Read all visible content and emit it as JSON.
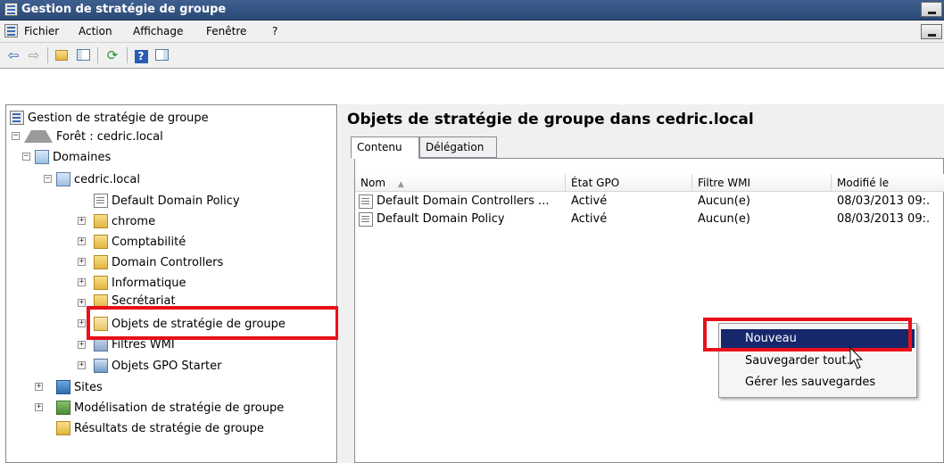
{
  "window": {
    "title": "Gestion de stratégie de groupe"
  },
  "menu": {
    "items": [
      "Fichier",
      "Action",
      "Affichage",
      "Fenêtre",
      "?"
    ]
  },
  "toolbar": {
    "buttons": [
      "back-icon",
      "forward-icon",
      "up-folder-icon",
      "show-hide-tree-icon",
      "refresh-icon",
      "help-icon",
      "show-action-pane-icon"
    ]
  },
  "tree": {
    "root": "Gestion de stratégie de groupe",
    "forest": "Forêt : cedric.local",
    "domains": "Domaines",
    "domain": "cedric.local",
    "children": [
      "Default Domain Policy",
      "chrome",
      "Comptabilité",
      "Domain Controllers",
      "Informatique",
      "Secrétariat",
      "Objets de stratégie de groupe",
      "Filtres WMI",
      "Objets GPO Starter"
    ],
    "sites": "Sites",
    "modeling": "Modélisation de stratégie de groupe",
    "results": "Résultats de stratégie de groupe"
  },
  "content": {
    "title": "Objets de stratégie de groupe dans cedric.local",
    "tabs": [
      "Contenu",
      "Délégation"
    ],
    "columns": [
      "Nom",
      "État GPO",
      "Filtre WMI",
      "Modifié le"
    ],
    "sort_indicator": "▲",
    "rows": [
      [
        "Default Domain Controllers ...",
        "Activé",
        "Aucun(e)",
        "08/03/2013 09:."
      ],
      [
        "Default Domain Policy",
        "Activé",
        "Aucun(e)",
        "08/03/2013 09:."
      ]
    ]
  },
  "context_menu": {
    "items": [
      "Nouveau",
      "Sauvegarder tout...",
      "Gérer les sauvegardes"
    ]
  },
  "colors": {
    "highlight": "#e8101a",
    "menu_selection": "#16276c",
    "titlebar": "#2b4a76"
  }
}
